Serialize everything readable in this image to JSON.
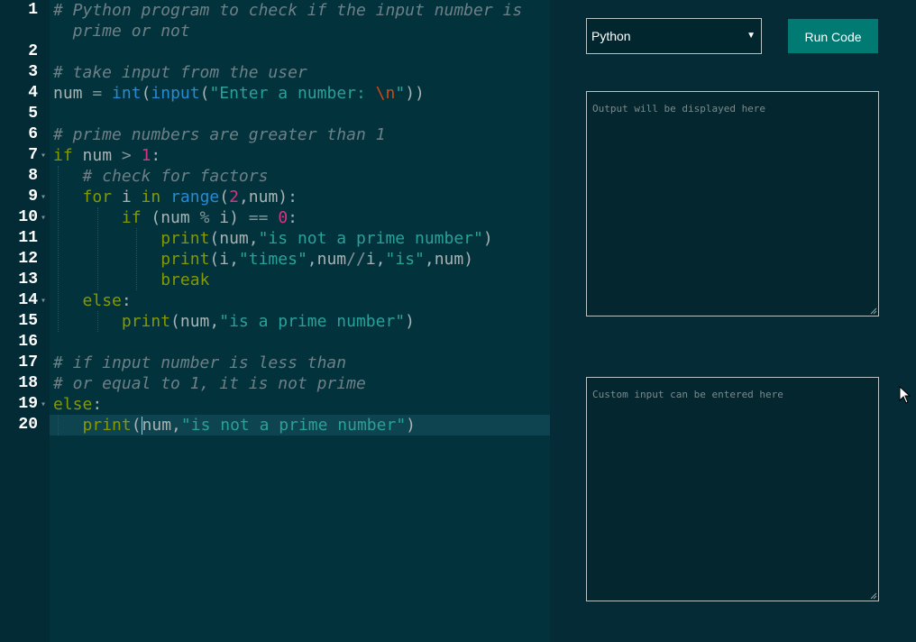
{
  "editor": {
    "active_line": 20,
    "lines": [
      {
        "n": "1",
        "fold": false,
        "tokens": [
          [
            "cmt",
            "# Python program to check if the input number is"
          ]
        ]
      },
      {
        "n": "",
        "fold": false,
        "tokens": [
          [
            "cmt",
            "  prime or not"
          ]
        ]
      },
      {
        "n": "2",
        "fold": false,
        "tokens": []
      },
      {
        "n": "3",
        "fold": false,
        "tokens": [
          [
            "cmt",
            "# take input from the user"
          ]
        ]
      },
      {
        "n": "4",
        "fold": false,
        "tokens": [
          [
            "plain",
            "num "
          ],
          [
            "op",
            "= "
          ],
          [
            "bi",
            "int"
          ],
          [
            "plain",
            "("
          ],
          [
            "bi",
            "input"
          ],
          [
            "plain",
            "("
          ],
          [
            "str",
            "\"Enter a number: "
          ],
          [
            "esc",
            "\\n"
          ],
          [
            "str",
            "\""
          ],
          [
            "plain",
            "))"
          ]
        ]
      },
      {
        "n": "5",
        "fold": false,
        "tokens": []
      },
      {
        "n": "6",
        "fold": false,
        "tokens": [
          [
            "cmt",
            "# prime numbers are greater than 1"
          ]
        ]
      },
      {
        "n": "7",
        "fold": true,
        "tokens": [
          [
            "kw",
            "if"
          ],
          [
            "plain",
            " num "
          ],
          [
            "op",
            ">"
          ],
          [
            "plain",
            " "
          ],
          [
            "num",
            "1"
          ],
          [
            "plain",
            ":"
          ]
        ]
      },
      {
        "n": "8",
        "fold": false,
        "tokens": [
          [
            "plain",
            "   "
          ],
          [
            "cmt",
            "# check for factors"
          ]
        ]
      },
      {
        "n": "9",
        "fold": true,
        "tokens": [
          [
            "plain",
            "   "
          ],
          [
            "kw",
            "for"
          ],
          [
            "plain",
            " i "
          ],
          [
            "kw",
            "in"
          ],
          [
            "plain",
            " "
          ],
          [
            "bi",
            "range"
          ],
          [
            "plain",
            "("
          ],
          [
            "num",
            "2"
          ],
          [
            "plain",
            ",num):"
          ]
        ]
      },
      {
        "n": "10",
        "fold": true,
        "tokens": [
          [
            "plain",
            "       "
          ],
          [
            "kw",
            "if"
          ],
          [
            "plain",
            " (num "
          ],
          [
            "op",
            "%"
          ],
          [
            "plain",
            " i) "
          ],
          [
            "op",
            "=="
          ],
          [
            "plain",
            " "
          ],
          [
            "num",
            "0"
          ],
          [
            "plain",
            ":"
          ]
        ]
      },
      {
        "n": "11",
        "fold": false,
        "tokens": [
          [
            "plain",
            "           "
          ],
          [
            "kw",
            "print"
          ],
          [
            "plain",
            "(num,"
          ],
          [
            "str",
            "\"is not a prime number\""
          ],
          [
            "plain",
            ")"
          ]
        ]
      },
      {
        "n": "12",
        "fold": false,
        "tokens": [
          [
            "plain",
            "           "
          ],
          [
            "kw",
            "print"
          ],
          [
            "plain",
            "(i,"
          ],
          [
            "str",
            "\"times\""
          ],
          [
            "plain",
            ",num"
          ],
          [
            "op",
            "//"
          ],
          [
            "plain",
            "i,"
          ],
          [
            "str",
            "\"is\""
          ],
          [
            "plain",
            ",num)"
          ]
        ]
      },
      {
        "n": "13",
        "fold": false,
        "tokens": [
          [
            "plain",
            "           "
          ],
          [
            "kw",
            "break"
          ]
        ]
      },
      {
        "n": "14",
        "fold": true,
        "tokens": [
          [
            "plain",
            "   "
          ],
          [
            "kw",
            "else"
          ],
          [
            "plain",
            ":"
          ]
        ]
      },
      {
        "n": "15",
        "fold": false,
        "tokens": [
          [
            "plain",
            "       "
          ],
          [
            "kw",
            "print"
          ],
          [
            "plain",
            "(num,"
          ],
          [
            "str",
            "\"is a prime number\""
          ],
          [
            "plain",
            ")"
          ]
        ]
      },
      {
        "n": "16",
        "fold": false,
        "tokens": []
      },
      {
        "n": "17",
        "fold": false,
        "tokens": [
          [
            "cmt",
            "# if input number is less than"
          ]
        ]
      },
      {
        "n": "18",
        "fold": false,
        "tokens": [
          [
            "cmt",
            "# or equal to 1, it is not prime"
          ]
        ]
      },
      {
        "n": "19",
        "fold": true,
        "tokens": [
          [
            "kw",
            "else"
          ],
          [
            "plain",
            ":"
          ]
        ]
      },
      {
        "n": "20",
        "fold": false,
        "tokens": [
          [
            "plain",
            "   "
          ],
          [
            "kw",
            "print"
          ],
          [
            "plain",
            "("
          ],
          [
            "cursor",
            ""
          ],
          [
            "plain",
            "num,"
          ],
          [
            "str",
            "\"is not a prime number\""
          ],
          [
            "plain",
            ")"
          ]
        ]
      }
    ]
  },
  "toolbar": {
    "language_selected": "Python",
    "run_label": "Run Code"
  },
  "output": {
    "placeholder": "Output will be displayed here"
  },
  "custom_input": {
    "placeholder": "Custom input can be entered here"
  },
  "colors": {
    "page_bg": "#042b36",
    "editor_bg": "#02323c",
    "accent_button": "#007a73",
    "keyword": "#859900",
    "builtin": "#268bd2",
    "string": "#2aa198",
    "number": "#d33682",
    "comment": "#6e8087"
  },
  "icons": {
    "dropdown_arrow": "chevron-down-icon",
    "resize_grip": "resize-grip-icon",
    "mouse_pointer": "mouse-pointer-icon",
    "fold_marker": "fold-arrow-icon"
  }
}
